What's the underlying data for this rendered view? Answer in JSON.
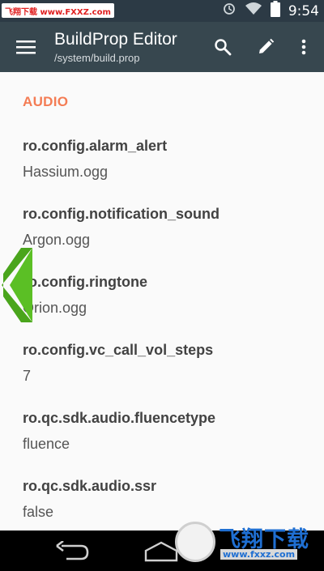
{
  "status_bar": {
    "watermark": "飞翔下载 www.FXXZ.com",
    "time": "9:54"
  },
  "app_bar": {
    "title": "BuildProp Editor",
    "subtitle": "/system/build.prop",
    "icons": [
      "menu-icon",
      "search-icon",
      "edit-icon",
      "more-vert-icon"
    ]
  },
  "section": {
    "header": "AUDIO"
  },
  "properties": [
    {
      "key": "ro.config.alarm_alert",
      "value": "Hassium.ogg"
    },
    {
      "key": "ro.config.notification_sound",
      "value": "Argon.ogg"
    },
    {
      "key": "ro.config.ringtone",
      "value": "Orion.ogg"
    },
    {
      "key": "ro.config.vc_call_vol_steps",
      "value": "7"
    },
    {
      "key": "ro.qc.sdk.audio.fluencetype",
      "value": "fluence"
    },
    {
      "key": "ro.qc.sdk.audio.ssr",
      "value": "false"
    }
  ],
  "watermark_logo": {
    "text": "飞翔下载",
    "url": "www.fxxz.com"
  },
  "colors": {
    "status_bar": "#2c3a45",
    "app_bar": "#37474f",
    "accent": "#f47c54",
    "chevron": "#4aa51c"
  }
}
